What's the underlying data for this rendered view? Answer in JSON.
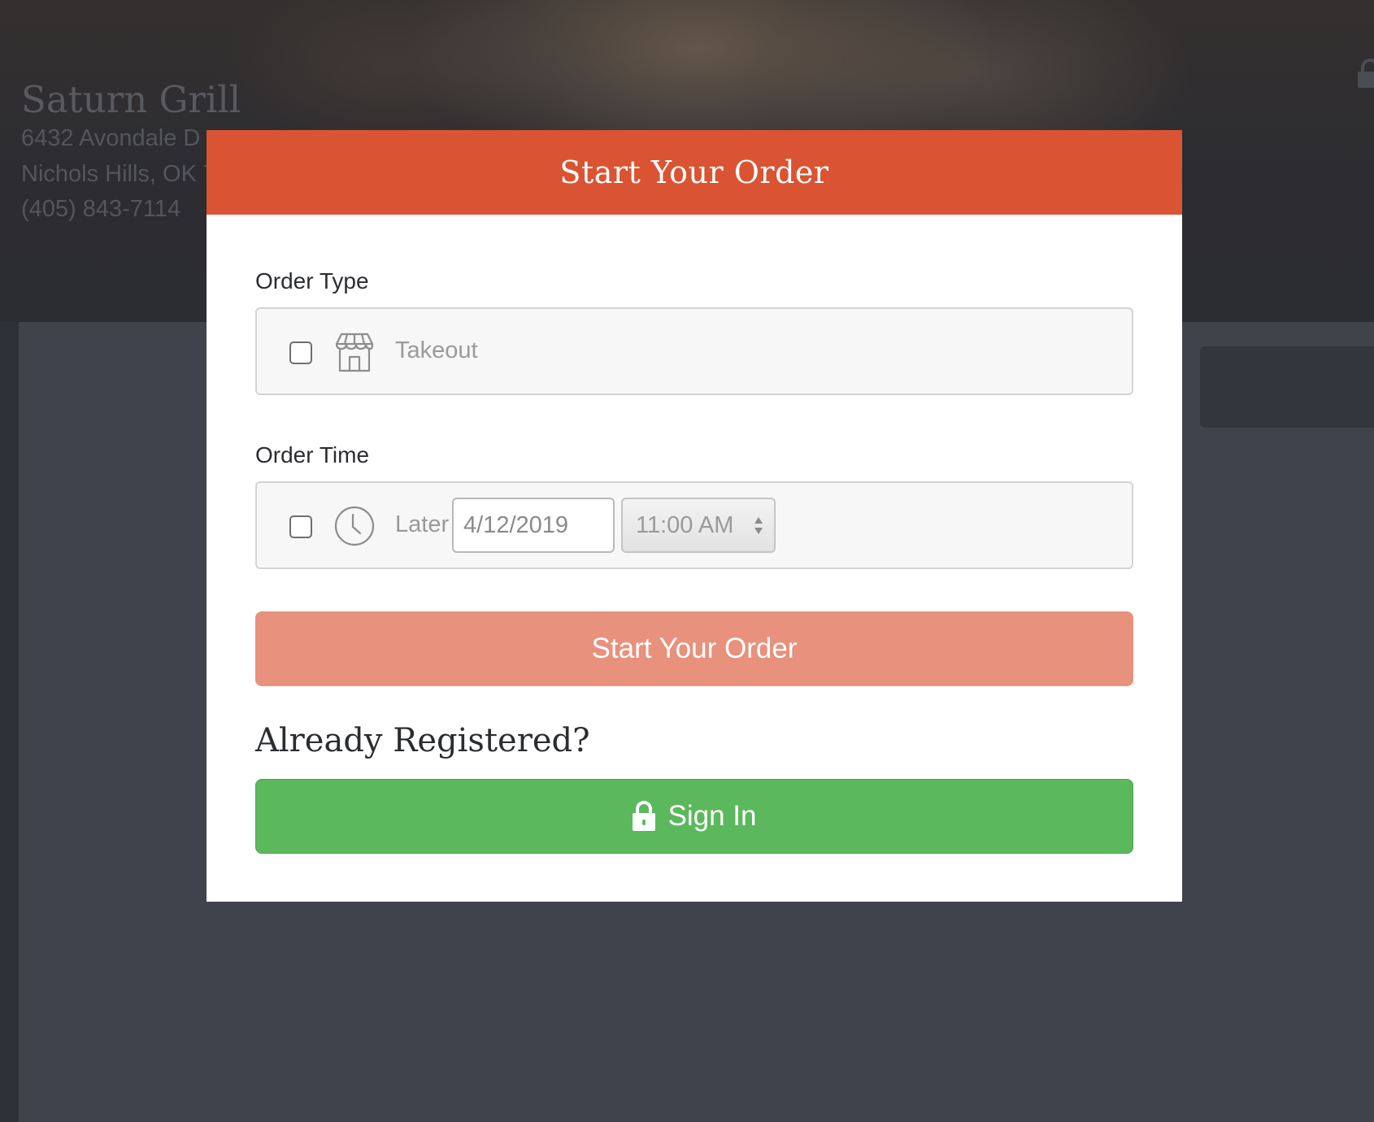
{
  "background": {
    "restaurant_name": "Saturn Grill",
    "address_line1": "6432 Avondale D",
    "address_line2": "Nichols Hills, OK 7",
    "phone": "(405) 843-7114"
  },
  "modal": {
    "title": "Start Your Order",
    "order_type": {
      "label": "Order Type",
      "option": {
        "label": "Takeout",
        "icon": "storefront-icon",
        "checked": false
      }
    },
    "order_time": {
      "label": "Order Time",
      "option": {
        "label": "Later",
        "icon": "clock-icon",
        "checked": false
      },
      "date_value": "4/12/2019",
      "time_value": "11:00 AM"
    },
    "start_button_label": "Start Your Order",
    "registered_heading": "Already Registered?",
    "sign_in_label": "Sign In"
  },
  "colors": {
    "header_accent": "#da5433",
    "start_button": "#e8917d",
    "sign_in_button": "#5cb85c",
    "overlay_background": "#40434b"
  }
}
